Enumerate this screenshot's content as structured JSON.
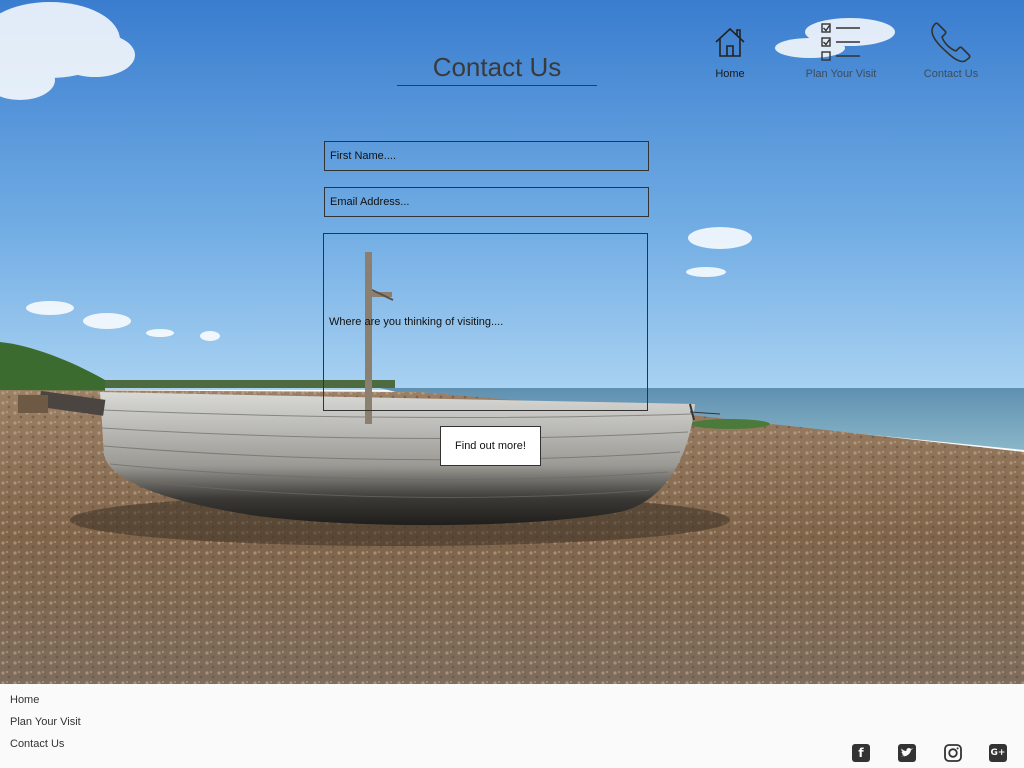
{
  "header": {
    "title": "Contact Us"
  },
  "nav": {
    "home": {
      "label": "Home",
      "icon": "home-icon"
    },
    "plan": {
      "label": "Plan Your Visit",
      "icon": "checklist-icon"
    },
    "contact": {
      "label": "Contact Us",
      "icon": "phone-icon"
    }
  },
  "form": {
    "first_name_placeholder": "First Name....",
    "email_placeholder": "Email Address...",
    "message_placeholder": "Where are you thinking of visiting....",
    "submit_label": "Find out more!"
  },
  "footer": {
    "links": [
      "Home",
      "Plan Your Visit",
      "Contact Us"
    ],
    "social": [
      {
        "name": "facebook-icon",
        "glyph": "f"
      },
      {
        "name": "twitter-icon",
        "glyph": "t"
      },
      {
        "name": "instagram-icon",
        "glyph": ""
      },
      {
        "name": "google-plus-icon",
        "glyph": "G+"
      }
    ]
  },
  "colors": {
    "sky_top": "#3b7fd0",
    "sky_bottom": "#9ecbf0",
    "sea": "#7aa6bf",
    "shingle": "#8a7259",
    "footer_bg": "#fafafa",
    "text_dark": "#3a3a3a"
  }
}
